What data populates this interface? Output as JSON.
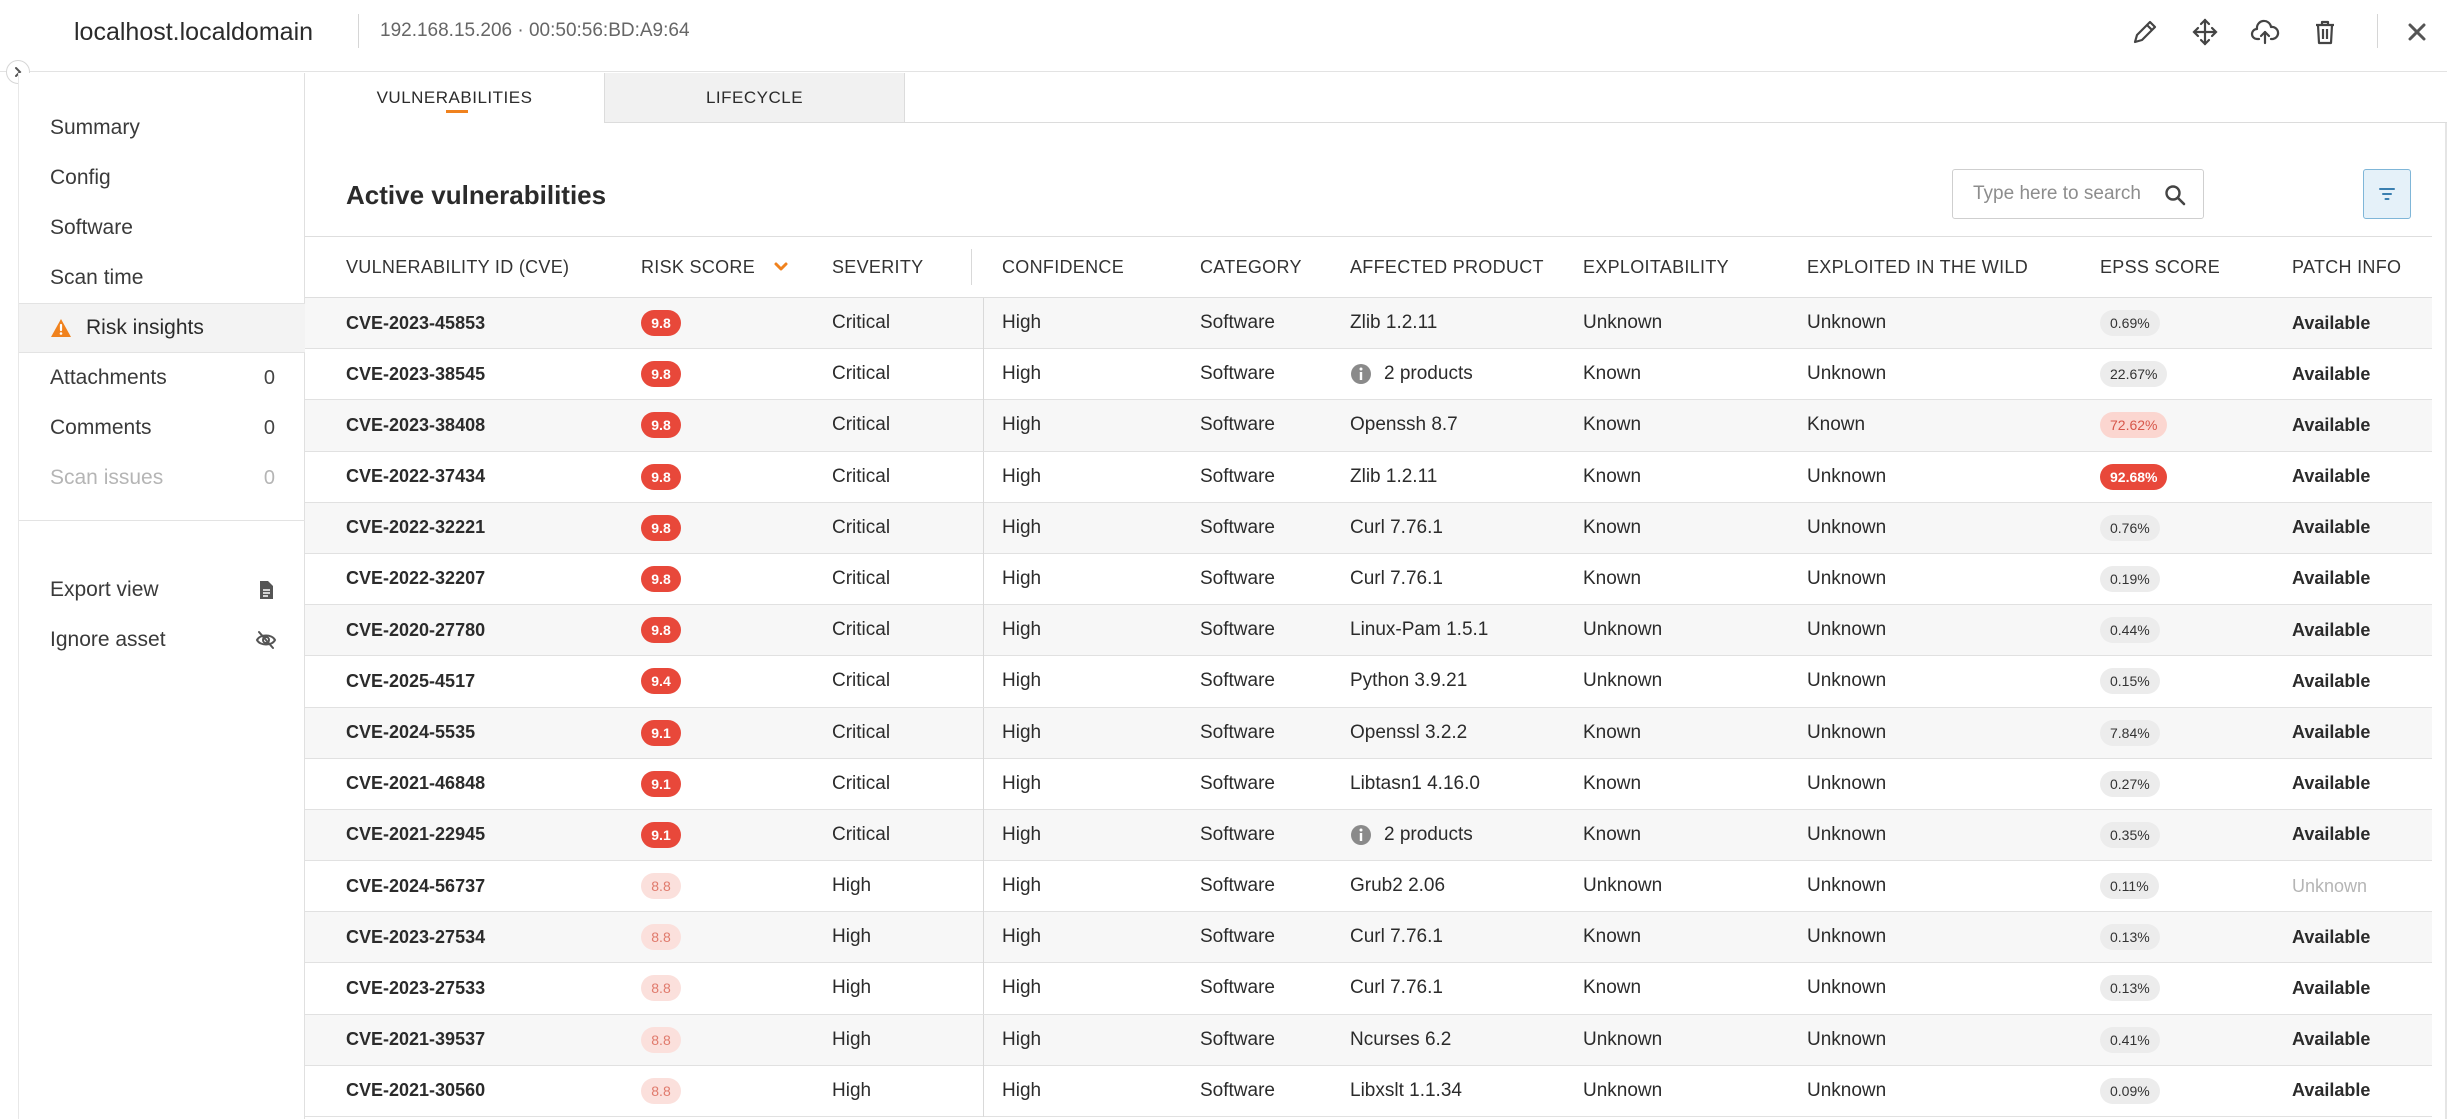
{
  "header": {
    "hostname": "localhost.localdomain",
    "ip": "192.168.15.206",
    "mac": "00:50:56:BD:A9:64",
    "meta_separator": "·"
  },
  "sidebar": {
    "items": [
      {
        "label": "Summary"
      },
      {
        "label": "Config"
      },
      {
        "label": "Software"
      },
      {
        "label": "Scan time"
      },
      {
        "label": "Risk insights"
      },
      {
        "label": "Attachments",
        "count": "0"
      },
      {
        "label": "Comments",
        "count": "0"
      },
      {
        "label": "Scan issues",
        "count": "0"
      }
    ],
    "actions": [
      {
        "label": "Export view"
      },
      {
        "label": "Ignore asset"
      }
    ]
  },
  "tabs": [
    {
      "label": "VULNERABILITIES"
    },
    {
      "label": "LIFECYCLE"
    }
  ],
  "main": {
    "title": "Active vulnerabilities",
    "search_placeholder": "Type here to search"
  },
  "table": {
    "columns": [
      "VULNERABILITY ID (CVE)",
      "RISK SCORE",
      "SEVERITY",
      "CONFIDENCE",
      "CATEGORY",
      "AFFECTED PRODUCT",
      "EXPLOITABILITY",
      "EXPLOITED IN THE WILD",
      "EPSS SCORE",
      "PATCH INFO"
    ],
    "rows": [
      {
        "cve": "CVE-2023-45853",
        "score": "9.8",
        "severity": "Critical",
        "confidence": "High",
        "category": "Software",
        "product": "Zlib 1.2.11",
        "exploitability": "Unknown",
        "wild": "Unknown",
        "epss": "0.69%",
        "patch": "Available"
      },
      {
        "cve": "CVE-2023-38545",
        "score": "9.8",
        "severity": "Critical",
        "confidence": "High",
        "category": "Software",
        "product": "2 products",
        "exploitability": "Known",
        "wild": "Unknown",
        "epss": "22.67%",
        "patch": "Available"
      },
      {
        "cve": "CVE-2023-38408",
        "score": "9.8",
        "severity": "Critical",
        "confidence": "High",
        "category": "Software",
        "product": "Openssh 8.7",
        "exploitability": "Known",
        "wild": "Known",
        "epss": "72.62%",
        "patch": "Available"
      },
      {
        "cve": "CVE-2022-37434",
        "score": "9.8",
        "severity": "Critical",
        "confidence": "High",
        "category": "Software",
        "product": "Zlib 1.2.11",
        "exploitability": "Known",
        "wild": "Unknown",
        "epss": "92.68%",
        "patch": "Available"
      },
      {
        "cve": "CVE-2022-32221",
        "score": "9.8",
        "severity": "Critical",
        "confidence": "High",
        "category": "Software",
        "product": "Curl 7.76.1",
        "exploitability": "Known",
        "wild": "Unknown",
        "epss": "0.76%",
        "patch": "Available"
      },
      {
        "cve": "CVE-2022-32207",
        "score": "9.8",
        "severity": "Critical",
        "confidence": "High",
        "category": "Software",
        "product": "Curl 7.76.1",
        "exploitability": "Known",
        "wild": "Unknown",
        "epss": "0.19%",
        "patch": "Available"
      },
      {
        "cve": "CVE-2020-27780",
        "score": "9.8",
        "severity": "Critical",
        "confidence": "High",
        "category": "Software",
        "product": "Linux-Pam 1.5.1",
        "exploitability": "Unknown",
        "wild": "Unknown",
        "epss": "0.44%",
        "patch": "Available"
      },
      {
        "cve": "CVE-2025-4517",
        "score": "9.4",
        "severity": "Critical",
        "confidence": "High",
        "category": "Software",
        "product": "Python 3.9.21",
        "exploitability": "Unknown",
        "wild": "Unknown",
        "epss": "0.15%",
        "patch": "Available"
      },
      {
        "cve": "CVE-2024-5535",
        "score": "9.1",
        "severity": "Critical",
        "confidence": "High",
        "category": "Software",
        "product": "Openssl 3.2.2",
        "exploitability": "Known",
        "wild": "Unknown",
        "epss": "7.84%",
        "patch": "Available"
      },
      {
        "cve": "CVE-2021-46848",
        "score": "9.1",
        "severity": "Critical",
        "confidence": "High",
        "category": "Software",
        "product": "Libtasn1 4.16.0",
        "exploitability": "Known",
        "wild": "Unknown",
        "epss": "0.27%",
        "patch": "Available"
      },
      {
        "cve": "CVE-2021-22945",
        "score": "9.1",
        "severity": "Critical",
        "confidence": "High",
        "category": "Software",
        "product": "2 products",
        "exploitability": "Known",
        "wild": "Unknown",
        "epss": "0.35%",
        "patch": "Available"
      },
      {
        "cve": "CVE-2024-56737",
        "score": "8.8",
        "severity": "High",
        "confidence": "High",
        "category": "Software",
        "product": "Grub2 2.06",
        "exploitability": "Unknown",
        "wild": "Unknown",
        "epss": "0.11%",
        "patch": "Unknown"
      },
      {
        "cve": "CVE-2023-27534",
        "score": "8.8",
        "severity": "High",
        "confidence": "High",
        "category": "Software",
        "product": "Curl 7.76.1",
        "exploitability": "Known",
        "wild": "Unknown",
        "epss": "0.13%",
        "patch": "Available"
      },
      {
        "cve": "CVE-2023-27533",
        "score": "8.8",
        "severity": "High",
        "confidence": "High",
        "category": "Software",
        "product": "Curl 7.76.1",
        "exploitability": "Known",
        "wild": "Unknown",
        "epss": "0.13%",
        "patch": "Available"
      },
      {
        "cve": "CVE-2021-39537",
        "score": "8.8",
        "severity": "High",
        "confidence": "High",
        "category": "Software",
        "product": "Ncurses 6.2",
        "exploitability": "Unknown",
        "wild": "Unknown",
        "epss": "0.41%",
        "patch": "Available"
      },
      {
        "cve": "CVE-2021-30560",
        "score": "8.8",
        "severity": "High",
        "confidence": "High",
        "category": "Software",
        "product": "Libxslt 1.1.34",
        "exploitability": "Unknown",
        "wild": "Unknown",
        "epss": "0.09%",
        "patch": "Available"
      }
    ]
  },
  "icons": {
    "edit": "pencil-icon",
    "network": "network-icon",
    "upload": "cloud-upload-icon",
    "delete": "trash-icon",
    "close": "close-icon",
    "search": "search-icon",
    "filter": "filter-icon",
    "warning": "warning-icon",
    "info": "info-icon",
    "export": "document-icon",
    "ignore": "eye-off-icon"
  },
  "colors": {
    "accent": "#f0821e",
    "critical": "#e8483a",
    "high_bg": "#fbe0dc",
    "filter_bg": "#e5f1f9"
  }
}
